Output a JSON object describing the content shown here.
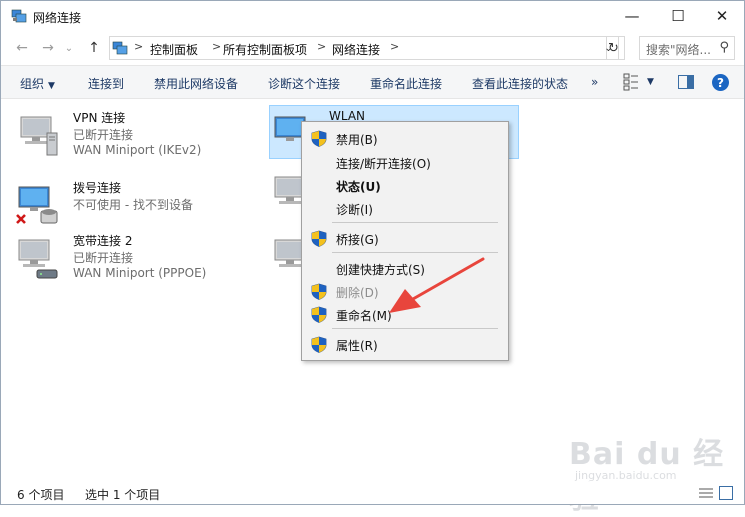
{
  "window": {
    "title": "网络连接",
    "buttons": {
      "minimize": "—",
      "maximize": "☐",
      "close": "✕"
    }
  },
  "nav": {
    "back": "←",
    "forward": "→",
    "dropdown": "⌄",
    "up": "↑",
    "breadcrumbs": [
      "控制面板",
      "所有控制面板项",
      "网络连接"
    ],
    "breadcrumb_sep": ">",
    "search_placeholder": "搜索\"网络...",
    "refresh": "↻",
    "addr_drop": "⌄"
  },
  "toolbar": {
    "organize": "组织",
    "items": [
      "连接到",
      "禁用此网络设备",
      "诊断这个连接",
      "重命名此连接",
      "查看此连接的状态"
    ],
    "more": "»",
    "help": "?"
  },
  "connections": [
    {
      "name": "VPN 连接",
      "status": "已断开连接",
      "device": "WAN Miniport (IKEv2)"
    },
    {
      "name": "拨号连接",
      "status": "不可使用 - 找不到设备",
      "device": ""
    },
    {
      "name": "宽带连接 2",
      "status": "已断开连接",
      "device": "WAN Miniport (PPPOE)"
    },
    {
      "name": "WLAN",
      "status": "",
      "device": ""
    }
  ],
  "context_menu": [
    {
      "label": "禁用(B)",
      "shield": true,
      "style": "normal"
    },
    {
      "label": "连接/断开连接(O)",
      "shield": false,
      "style": "normal"
    },
    {
      "label": "状态(U)",
      "shield": false,
      "style": "bold"
    },
    {
      "label": "诊断(I)",
      "shield": false,
      "style": "normal"
    },
    {
      "label": "桥接(G)",
      "shield": true,
      "style": "normal"
    },
    {
      "label": "创建快捷方式(S)",
      "shield": false,
      "style": "normal"
    },
    {
      "label": "删除(D)",
      "shield": true,
      "style": "disabled"
    },
    {
      "label": "重命名(M)",
      "shield": true,
      "style": "normal"
    },
    {
      "label": "属性(R)",
      "shield": true,
      "style": "normal"
    }
  ],
  "status": {
    "count": "6 个项目",
    "selected": "选中 1 个项目"
  },
  "watermark": {
    "main": "Bai du 经验",
    "sub": "jingyan.baidu.com"
  },
  "colors": {
    "selection": "#cce8ff",
    "accent": "#1c66c2",
    "arrow": "#e8453c"
  }
}
